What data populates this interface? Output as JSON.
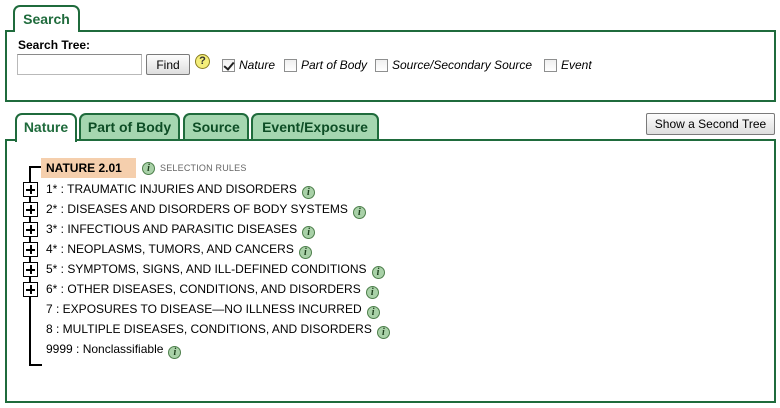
{
  "search": {
    "tab_label": "Search",
    "label": "Search Tree:",
    "input_value": "",
    "find_label": "Find",
    "help_glyph": "?",
    "filters": [
      {
        "label": "Nature",
        "checked": true
      },
      {
        "label": "Part of Body",
        "checked": false
      },
      {
        "label": "Source/Secondary Source",
        "checked": false
      },
      {
        "label": "Event",
        "checked": false
      }
    ]
  },
  "tabs": [
    {
      "label": "Nature",
      "active": true
    },
    {
      "label": "Part of Body",
      "active": false
    },
    {
      "label": "Source",
      "active": false
    },
    {
      "label": "Event/Exposure",
      "active": false
    }
  ],
  "show_second_tree_label": "Show a Second Tree",
  "tree": {
    "root_label": "NATURE 2.01",
    "selection_rules": "SELECTION RULES",
    "info_glyph": "i",
    "items": [
      {
        "label": "1* : TRAUMATIC INJURIES AND DISORDERS",
        "expandable": true
      },
      {
        "label": "2* : DISEASES AND DISORDERS OF BODY SYSTEMS",
        "expandable": true
      },
      {
        "label": "3* : INFECTIOUS AND PARASITIC DISEASES",
        "expandable": true
      },
      {
        "label": "4* : NEOPLASMS, TUMORS, AND CANCERS",
        "expandable": true
      },
      {
        "label": "5* : SYMPTOMS, SIGNS, AND ILL-DEFINED CONDITIONS",
        "expandable": true
      },
      {
        "label": "6* : OTHER DISEASES, CONDITIONS, AND DISORDERS",
        "expandable": true
      },
      {
        "label": "7 : EXPOSURES TO DISEASE—NO ILLNESS INCURRED",
        "expandable": false
      },
      {
        "label": "8 : MULTIPLE DISEASES, CONDITIONS, AND DISORDERS",
        "expandable": false
      },
      {
        "label": "9999 : Nonclassifiable",
        "expandable": false
      }
    ]
  },
  "colors": {
    "border_green": "#1f6b3c",
    "inactive_tab_bg": "#a5d6b0",
    "root_highlight": "#f5cfad",
    "info_icon_bg": "#a9d1a8"
  }
}
